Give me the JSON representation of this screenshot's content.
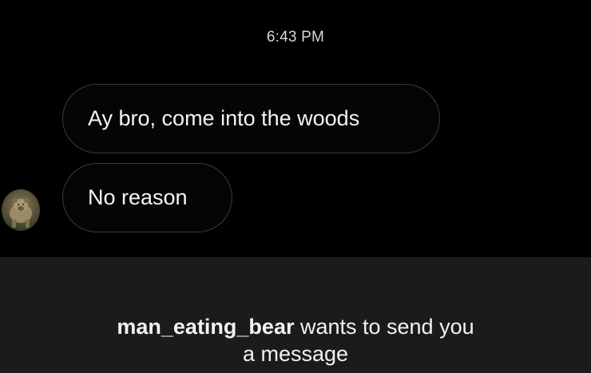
{
  "chat": {
    "timestamp": "6:43 PM",
    "messages": [
      {
        "text": "Ay bro, come into the woods"
      },
      {
        "text": "No reason"
      }
    ],
    "sender_avatar_icon": "bear-avatar-icon"
  },
  "request_banner": {
    "username": "man_eating_bear",
    "line1_rest": " wants to send you",
    "line2": "a message"
  },
  "colors": {
    "background": "#000000",
    "footer_background": "#1b1b1b",
    "bubble_border": "#3a3a3a",
    "text": "#f2f2f2"
  }
}
